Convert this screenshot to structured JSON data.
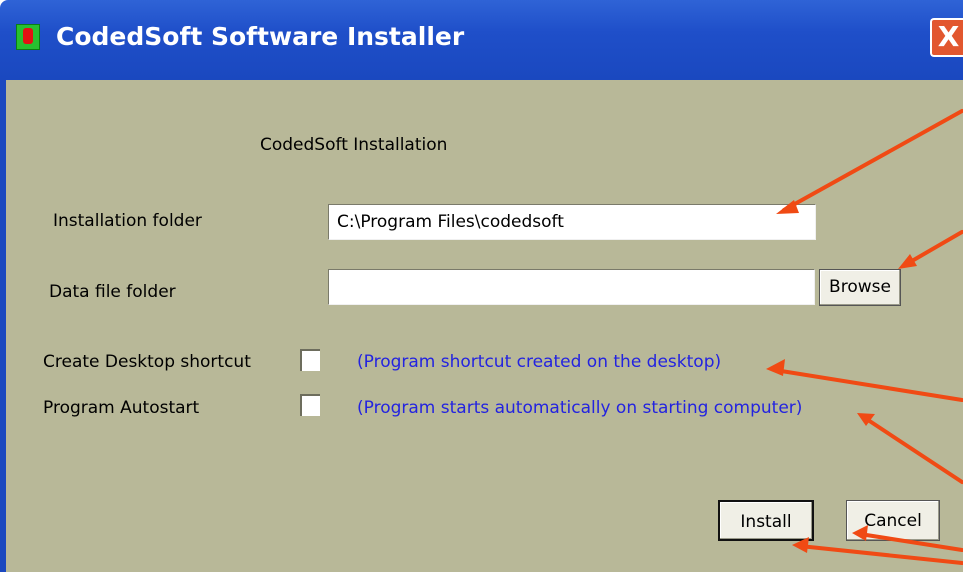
{
  "window": {
    "title": "CodedSoft Software Installer",
    "close_label": "X"
  },
  "form": {
    "heading": "CodedSoft Installation",
    "installation_folder_label": "Installation folder",
    "installation_folder_value": "C:\\Program Files\\codedsoft",
    "data_file_folder_label": "Data file folder",
    "data_file_folder_value": "",
    "browse_label": "Browse",
    "desktop_shortcut_label": "Create Desktop shortcut",
    "desktop_shortcut_note": "(Program shortcut created on the desktop)",
    "desktop_shortcut_checked": false,
    "autostart_label": "Program Autostart",
    "autostart_note": "(Program starts automatically on starting computer)",
    "autostart_checked": false,
    "install_label": "Install",
    "cancel_label": "Cancel"
  },
  "colors": {
    "titlebar": "#1f4fc9",
    "client_bg": "#b8b898",
    "note_text": "#2323e0",
    "annotation_arrow": "#f04a14"
  },
  "icons": [
    "app-icon",
    "close-icon",
    "annotation-arrow"
  ]
}
